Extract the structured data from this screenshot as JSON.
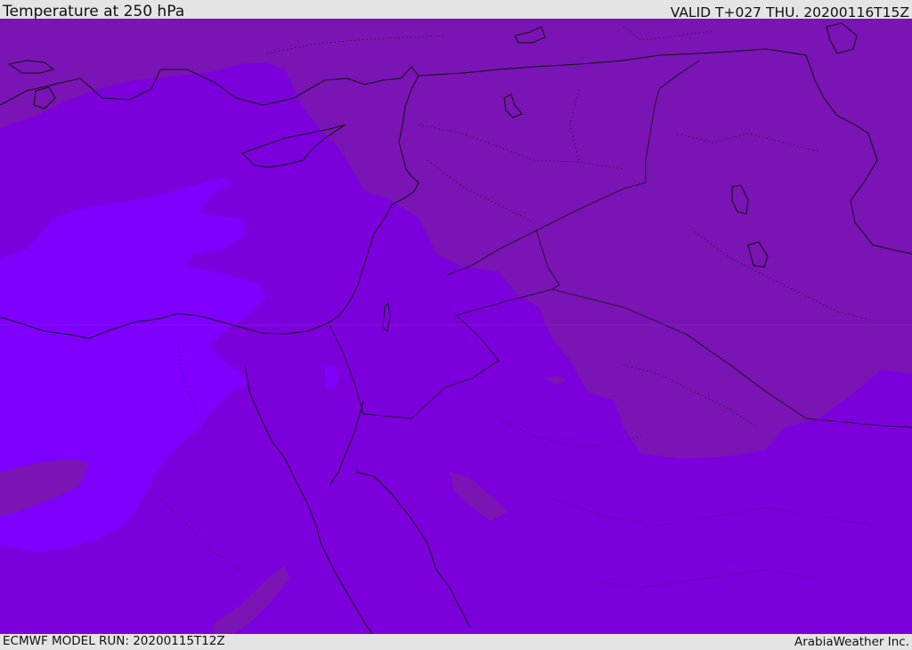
{
  "header": {
    "title": "Temperature at 250 hPa",
    "valid": "VALID T+027 THU. 20200116T15Z"
  },
  "footer": {
    "model_run": "ECMWF MODEL RUN: 20200115T12Z",
    "credit": "ArabiaWeather Inc."
  },
  "colors": {
    "warm_region": "#7a14b4",
    "mid_region": "#7c00dc",
    "cool_region": "#7f00ff",
    "coastline": "#101010",
    "bar_background": "#e4e4e4"
  }
}
